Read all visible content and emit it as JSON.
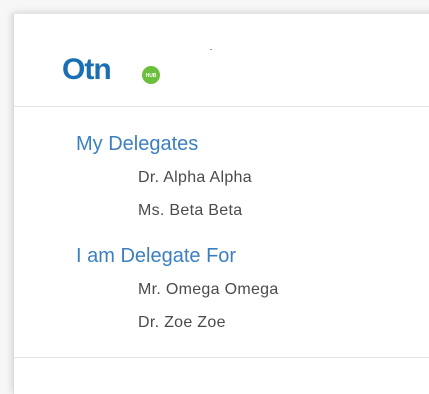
{
  "brand": {
    "logo_text": "Otn",
    "logo_badge": "HUB",
    "colors": {
      "primary_blue": "#1a6fb4",
      "accent_green": "#6cbf3c",
      "link_blue": "#3c7fc0"
    }
  },
  "my_delegates": {
    "title": "My Delegates",
    "items": [
      {
        "name": "Dr. Alpha Alpha"
      },
      {
        "name": "Ms. Beta Beta"
      }
    ]
  },
  "delegate_for": {
    "title": "I am Delegate For",
    "items": [
      {
        "name": "Mr. Omega Omega"
      },
      {
        "name": "Dr. Zoe Zoe"
      }
    ]
  }
}
